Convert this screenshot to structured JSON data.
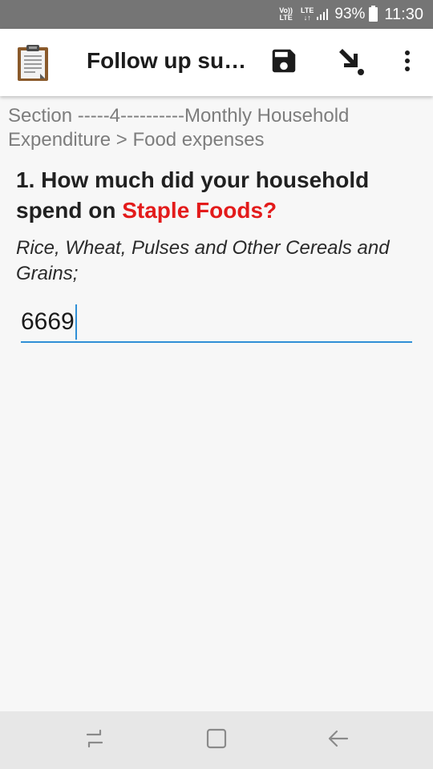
{
  "status_bar": {
    "volte_top": "Vo))",
    "volte_bottom": "LTE",
    "lte_label": "LTE",
    "battery_percent": "93%",
    "time": "11:30"
  },
  "app_bar": {
    "title": "Follow up su…",
    "icons": {
      "app": "clipboard-icon",
      "save": "save-icon",
      "goto": "go-to-arrow-icon",
      "menu": "more-vert-icon"
    }
  },
  "breadcrumb": "Section -----4----------Monthly Household Expenditure > Food expenses",
  "question": {
    "prefix": "1. How much did your household spend on ",
    "highlight": "Staple Foods?",
    "hint": "Rice, Wheat, Pulses and Other Cereals and Grains;",
    "answer": "6669"
  },
  "nav_bar": {
    "recent": "recent-apps-icon",
    "home": "home-icon",
    "back": "back-icon"
  },
  "colors": {
    "status_bar": "#757575",
    "highlight": "#e31b1b",
    "input_underline": "#2f8fd6",
    "nav_bar": "#e7e7e7"
  }
}
